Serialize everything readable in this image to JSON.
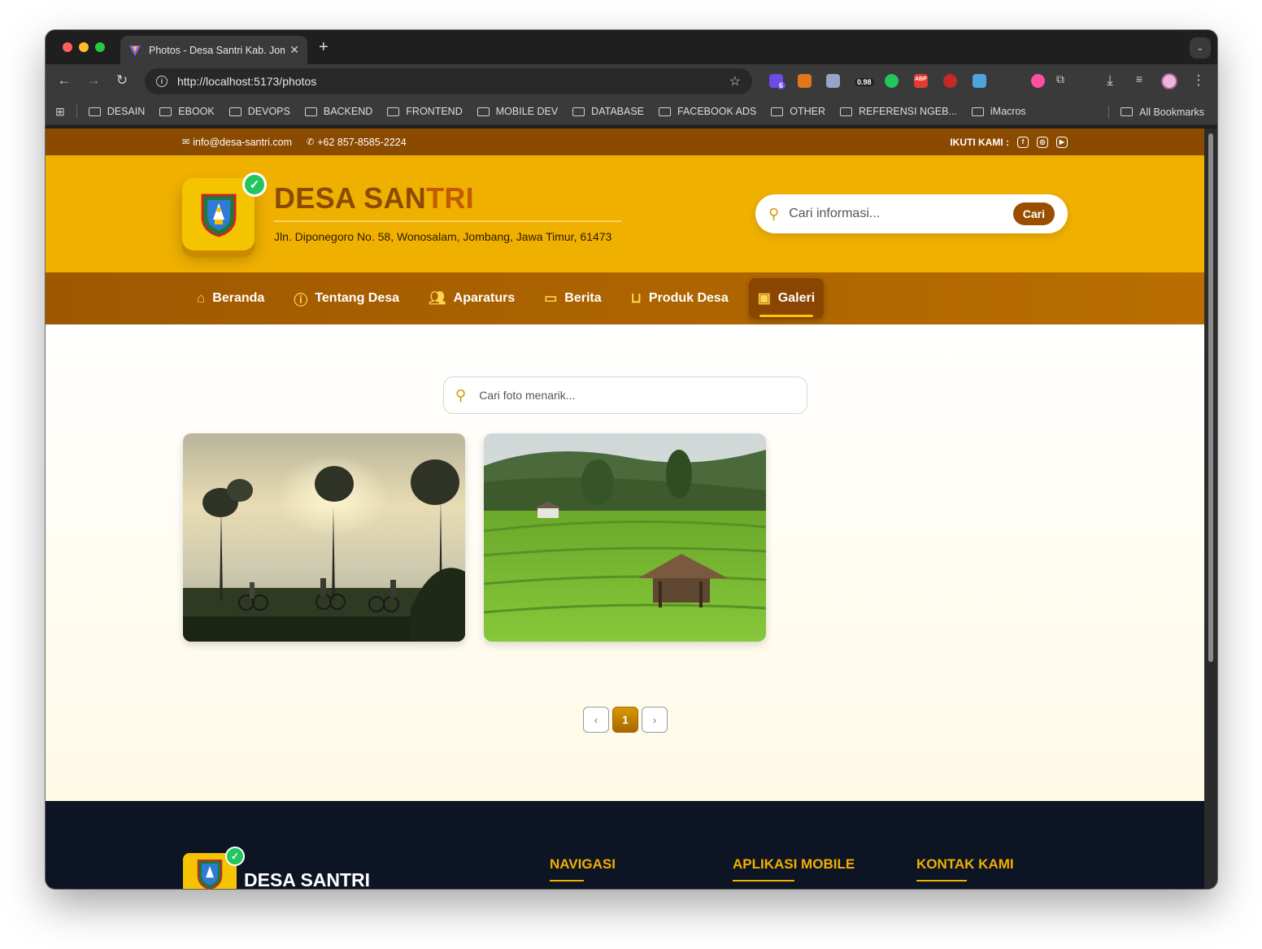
{
  "browser": {
    "tab_title": "Photos - Desa Santri Kab. Jombang",
    "url": "http://localhost:5173/photos",
    "extensions": [
      {
        "name": "extension-purple-icon",
        "badge": "6",
        "color": "#6b4ce6"
      },
      {
        "name": "metamask-icon",
        "badge": "",
        "color": "#e2761b"
      },
      {
        "name": "brain-icon",
        "badge": "",
        "color": "#9aa3c7"
      },
      {
        "name": "zoom-indicator-icon",
        "badge": "0.98",
        "color": "#3a3a3a"
      },
      {
        "name": "green-dot-icon",
        "badge": "",
        "color": "#22c55e"
      },
      {
        "name": "adblock-icon",
        "badge": "ABP",
        "color": "#e53935"
      },
      {
        "name": "block-icon",
        "badge": "",
        "color": "#c62828"
      },
      {
        "name": "bookmark-ext-icon",
        "badge": "",
        "color": "#4fa3e0"
      },
      {
        "name": "screenshot-icon",
        "badge": "",
        "color": "#3a3a3a"
      },
      {
        "name": "color-picker-icon",
        "badge": "",
        "color": "#ff4fa0"
      }
    ],
    "bookmarks": [
      "DESAIN",
      "EBOOK",
      "DEVOPS",
      "BACKEND",
      "FRONTEND",
      "MOBILE DEV",
      "DATABASE",
      "FACEBOOK ADS",
      "OTHER",
      "REFERENSI NGEB...",
      "iMacros"
    ],
    "all_bookmarks": "All Bookmarks"
  },
  "topbar": {
    "email": "info@desa-santri.com",
    "phone": "+62 857-8585-2224",
    "follow_label": "IKUTI KAMI :",
    "socials": [
      "facebook-icon",
      "instagram-icon",
      "youtube-icon"
    ]
  },
  "header": {
    "title_main": "DESA SAN",
    "title_highlight": "TRI",
    "address": "Jln. Diponegoro No. 58, Wonosalam, Jombang, Jawa Timur, 61473",
    "search_placeholder": "Cari informasi...",
    "search_button": "Cari"
  },
  "nav": {
    "items": [
      {
        "label": "Beranda",
        "icon": "home-icon",
        "active": false
      },
      {
        "label": "Tentang Desa",
        "icon": "info-icon",
        "active": false
      },
      {
        "label": "Aparaturs",
        "icon": "users-icon",
        "active": false
      },
      {
        "label": "Berita",
        "icon": "book-icon",
        "active": false
      },
      {
        "label": "Produk Desa",
        "icon": "shopping-bag-icon",
        "active": false
      },
      {
        "label": "Galeri",
        "icon": "image-icon",
        "active": true
      }
    ]
  },
  "gallery": {
    "search_placeholder": "Cari foto menarik...",
    "photos": [
      "cyclists-sunrise-photo",
      "rice-terrace-hut-photo"
    ],
    "pagination": {
      "current": "1",
      "prev": "‹",
      "next": "›"
    }
  },
  "footer": {
    "title": "DESA SANTRI",
    "headings": [
      "NAVIGASI",
      "APLIKASI MOBILE",
      "KONTAK KAMI"
    ]
  },
  "colors": {
    "brand_brown": "#8a4a00",
    "brand_yellow": "#f0b000",
    "footer_bg": "#0d1424",
    "verified_green": "#22c55e"
  }
}
